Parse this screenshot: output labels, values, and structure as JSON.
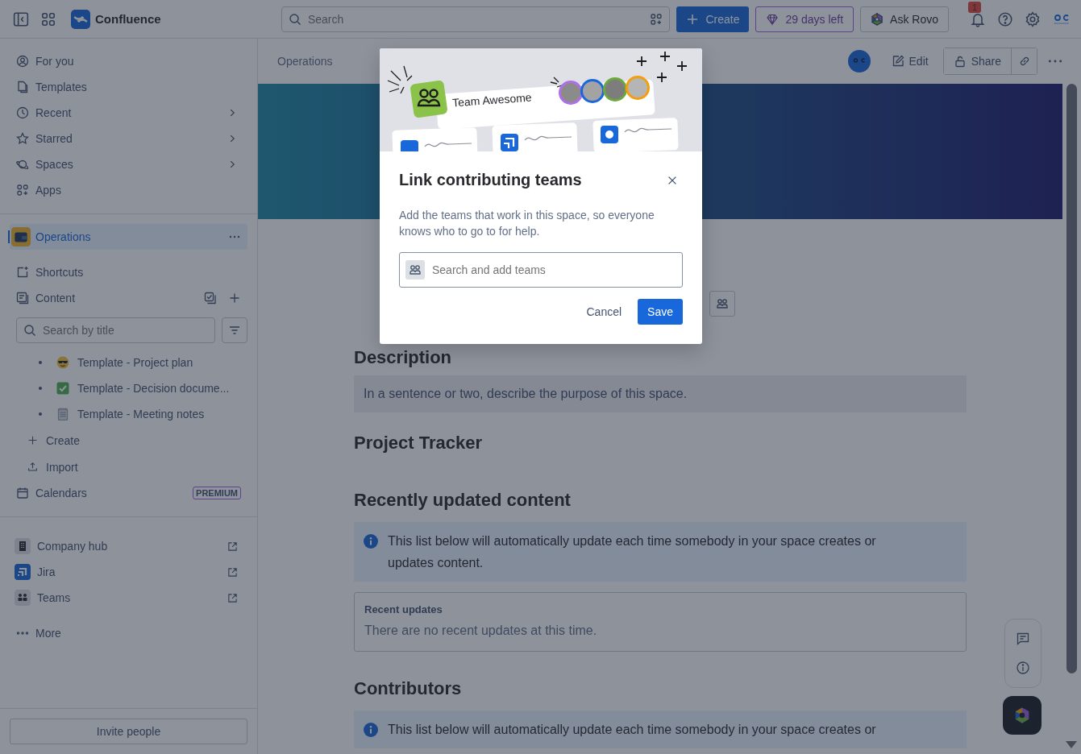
{
  "top_bar": {
    "app_name": "Confluence",
    "search": {
      "placeholder": "Search"
    },
    "create_button": "Create",
    "trial_button": "29 days left",
    "rovo_button": "Ask Rovo",
    "notification_count": "1"
  },
  "sidebar": {
    "nav": [
      {
        "label": "For you",
        "chevron": false
      },
      {
        "label": "Templates",
        "chevron": false
      },
      {
        "label": "Recent",
        "chevron": true
      },
      {
        "label": "Starred",
        "chevron": true
      },
      {
        "label": "Spaces",
        "chevron": true
      },
      {
        "label": "Apps",
        "chevron": false
      }
    ],
    "space": {
      "name": "Operations",
      "selected": true
    },
    "space_items": [
      {
        "label": "Shortcuts"
      },
      {
        "label": "Content"
      }
    ],
    "content_search": {
      "placeholder": "Search by title"
    },
    "pages": [
      {
        "title": "Template - Project plan"
      },
      {
        "title": "Template - Decision docume..."
      },
      {
        "title": "Template - Meeting notes"
      }
    ],
    "actions": [
      {
        "label": "Create"
      },
      {
        "label": "Import"
      }
    ],
    "calendars": {
      "label": "Calendars",
      "badge": "PREMIUM"
    },
    "apps": [
      {
        "label": "Company hub"
      },
      {
        "label": "Jira"
      },
      {
        "label": "Teams"
      }
    ],
    "more": "More",
    "invite_button": "Invite people"
  },
  "page": {
    "breadcrumb": "Operations",
    "edit_button": "Edit",
    "share_button": "Share",
    "sections": [
      {
        "kind": "heading",
        "text": "Description"
      },
      {
        "kind": "placeholder",
        "text": "In a sentence or two, describe the purpose of this space."
      },
      {
        "kind": "heading",
        "text": "Project Tracker"
      },
      {
        "kind": "heading",
        "text": "Recently updated content"
      },
      {
        "kind": "info",
        "text": "This list below will automatically update each time somebody in your space creates or updates content."
      },
      {
        "kind": "updates",
        "title": "Recent updates",
        "text": "There are no recent updates at this time."
      },
      {
        "kind": "heading",
        "text": "Contributors"
      },
      {
        "kind": "info",
        "text": "This list below will automatically update each time somebody in your space creates or"
      }
    ]
  },
  "dialog": {
    "illustration_label": "Team Awesome",
    "title": "Link contributing teams",
    "description": "Add the teams that work in this space, so everyone knows who to go to for help.",
    "field": {
      "placeholder": "Search and add teams"
    },
    "cancel_button": "Cancel",
    "save_button": "Save"
  }
}
